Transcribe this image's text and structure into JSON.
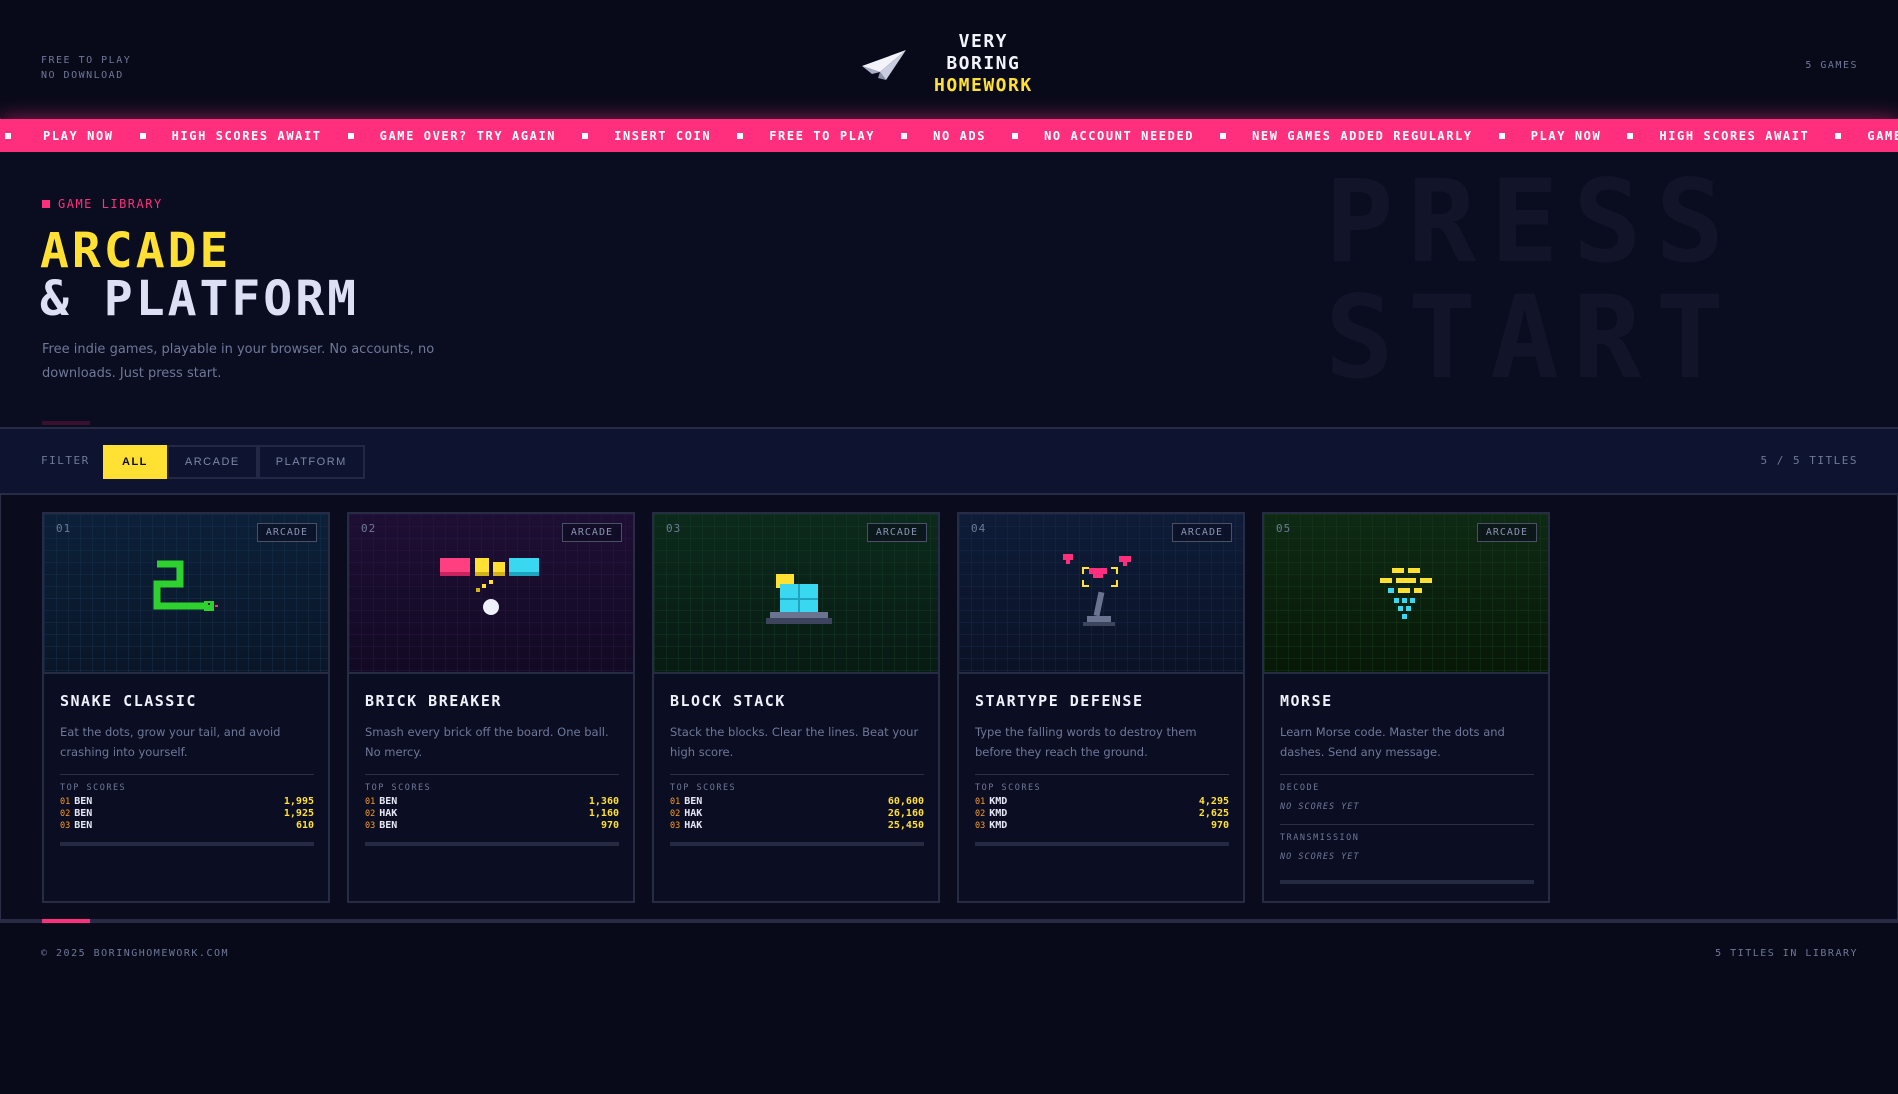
{
  "header": {
    "left_line1": "FREE TO PLAY",
    "left_line2": "NO DOWNLOAD",
    "logo_line1": "VERY",
    "logo_line2": "BORING",
    "logo_line3": "HOMEWORK",
    "logo_icon": "paper-plane-icon",
    "games_count": "5 GAMES"
  },
  "ticker": [
    "PLAY NOW",
    "HIGH SCORES AWAIT",
    "GAME OVER? TRY AGAIN",
    "INSERT COIN",
    "FREE TO PLAY",
    "NO ADS",
    "NO ACCOUNT NEEDED",
    "NEW GAMES ADDED REGULARLY",
    "PLAY NOW",
    "HIGH SCORES AWAIT",
    "GAME"
  ],
  "hero": {
    "label": "GAME LIBRARY",
    "title_line1": "ARCADE",
    "title_line2": "& PLATFORM",
    "description": "Free indie games, playable in your browser. No accounts, no downloads. Just press start.",
    "bg_line1": "PRESS",
    "bg_line2": "START"
  },
  "filter": {
    "label": "FILTER",
    "options": [
      "ALL",
      "ARCADE",
      "PLATFORM"
    ],
    "selected": "ALL",
    "count": "5 / 5 TITLES"
  },
  "games": [
    {
      "num": "01",
      "tag": "ARCADE",
      "title": "SNAKE CLASSIC",
      "description": "Eat the dots, grow your tail, and avoid crashing into yourself.",
      "scores_label": "TOP SCORES",
      "scores": [
        {
          "rank": "01",
          "name": "BEN",
          "score": "1,995"
        },
        {
          "rank": "02",
          "name": "BEN",
          "score": "1,925"
        },
        {
          "rank": "03",
          "name": "BEN",
          "score": "610"
        }
      ]
    },
    {
      "num": "02",
      "tag": "ARCADE",
      "title": "BRICK BREAKER",
      "description": "Smash every brick off the board. One ball. No mercy.",
      "scores_label": "TOP SCORES",
      "scores": [
        {
          "rank": "01",
          "name": "BEN",
          "score": "1,360"
        },
        {
          "rank": "02",
          "name": "HAK",
          "score": "1,160"
        },
        {
          "rank": "03",
          "name": "BEN",
          "score": "970"
        }
      ]
    },
    {
      "num": "03",
      "tag": "ARCADE",
      "title": "BLOCK STACK",
      "description": "Stack the blocks. Clear the lines. Beat your high score.",
      "scores_label": "TOP SCORES",
      "scores": [
        {
          "rank": "01",
          "name": "BEN",
          "score": "60,600"
        },
        {
          "rank": "02",
          "name": "HAK",
          "score": "26,160"
        },
        {
          "rank": "03",
          "name": "HAK",
          "score": "25,450"
        }
      ]
    },
    {
      "num": "04",
      "tag": "ARCADE",
      "title": "STARTYPE DEFENSE",
      "description": "Type the falling words to destroy them before they reach the ground.",
      "scores_label": "TOP SCORES",
      "scores": [
        {
          "rank": "01",
          "name": "KMD",
          "score": "4,295"
        },
        {
          "rank": "02",
          "name": "KMD",
          "score": "2,625"
        },
        {
          "rank": "03",
          "name": "KMD",
          "score": "970"
        }
      ]
    },
    {
      "num": "05",
      "tag": "ARCADE",
      "title": "MORSE",
      "description": "Learn Morse code. Master the dots and dashes. Send any message.",
      "modes": [
        {
          "label": "DECODE",
          "empty": "NO SCORES YET"
        },
        {
          "label": "TRANSMISSION",
          "empty": "NO SCORES YET"
        }
      ]
    }
  ],
  "footer": {
    "copyright": "© 2025 BORINGHOMEWORK.COM",
    "titles": "5 TITLES IN LIBRARY"
  },
  "colors": {
    "accent_yellow": "#ffe033",
    "accent_pink": "#ff2f7d",
    "background": "#0a0c1e",
    "snake_green": "#2ed12e",
    "cyan": "#3ad8f0"
  }
}
